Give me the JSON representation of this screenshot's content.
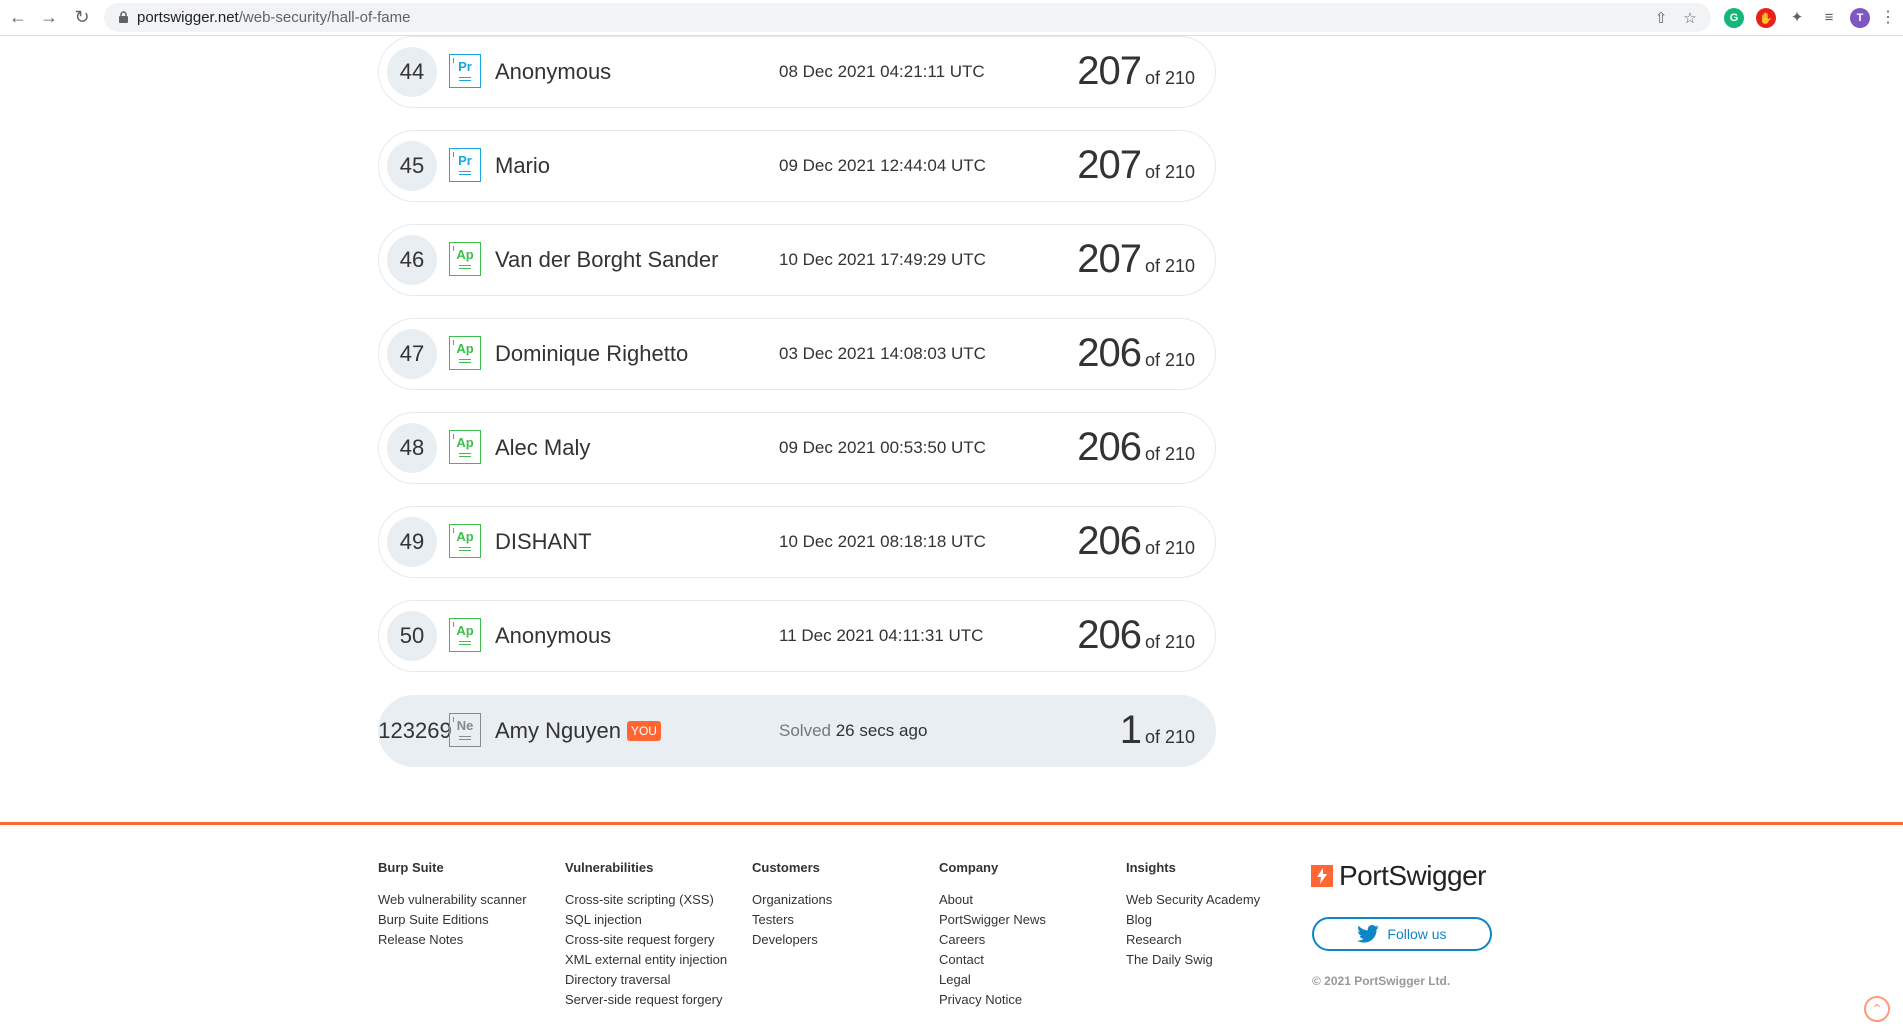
{
  "browser": {
    "url_host": "portswigger.net",
    "url_path": "/web-security/hall-of-fame",
    "profile_initial": "T"
  },
  "colors": {
    "accent": "#ff6633",
    "practitioner": "#1aa7e0",
    "apprentice": "#3cbf4b",
    "newcomer": "#8a8a8a"
  },
  "leaderboard": [
    {
      "rank": "44",
      "level": "Pr",
      "level_color": "practitioner",
      "name": "Anonymous",
      "date": "08 Dec 2021 04:21:11 UTC",
      "score": "207",
      "total": "of 210"
    },
    {
      "rank": "45",
      "level": "Pr",
      "level_color": "practitioner",
      "name": "Mario",
      "date": "09 Dec 2021 12:44:04 UTC",
      "score": "207",
      "total": "of 210"
    },
    {
      "rank": "46",
      "level": "Ap",
      "level_color": "apprentice",
      "name": "Van der Borght Sander",
      "date": "10 Dec 2021 17:49:29 UTC",
      "score": "207",
      "total": "of 210"
    },
    {
      "rank": "47",
      "level": "Ap",
      "level_color": "apprentice",
      "name": "Dominique Righetto",
      "date": "03 Dec 2021 14:08:03 UTC",
      "score": "206",
      "total": "of 210"
    },
    {
      "rank": "48",
      "level": "Ap",
      "level_color": "apprentice",
      "name": "Alec Maly",
      "date": "09 Dec 2021 00:53:50 UTC",
      "score": "206",
      "total": "of 210"
    },
    {
      "rank": "49",
      "level": "Ap",
      "level_color": "apprentice",
      "name": "DISHANT",
      "date": "10 Dec 2021 08:18:18 UTC",
      "score": "206",
      "total": "of 210"
    },
    {
      "rank": "50",
      "level": "Ap",
      "level_color": "apprentice",
      "name": "Anonymous",
      "date": "11 Dec 2021 04:11:31 UTC",
      "score": "206",
      "total": "of 210"
    }
  ],
  "current_user": {
    "rank": "123269",
    "level": "Ne",
    "name": "Amy Nguyen",
    "you_badge": "YOU",
    "solved_label": "Solved",
    "solved_time": "26 secs ago",
    "score": "1",
    "total": "of 210"
  },
  "footer": {
    "columns": [
      {
        "heading": "Burp Suite",
        "links": [
          "Web vulnerability scanner",
          "Burp Suite Editions",
          "Release Notes"
        ]
      },
      {
        "heading": "Vulnerabilities",
        "links": [
          "Cross-site scripting (XSS)",
          "SQL injection",
          "Cross-site request forgery",
          "XML external entity injection",
          "Directory traversal",
          "Server-side request forgery"
        ]
      },
      {
        "heading": "Customers",
        "links": [
          "Organizations",
          "Testers",
          "Developers"
        ]
      },
      {
        "heading": "Company",
        "links": [
          "About",
          "PortSwigger News",
          "Careers",
          "Contact",
          "Legal",
          "Privacy Notice"
        ]
      },
      {
        "heading": "Insights",
        "links": [
          "Web Security Academy",
          "Blog",
          "Research",
          "The Daily Swig"
        ]
      }
    ],
    "brand": "PortSwigger",
    "follow_label": "Follow us",
    "copyright": "© 2021 PortSwigger Ltd."
  }
}
